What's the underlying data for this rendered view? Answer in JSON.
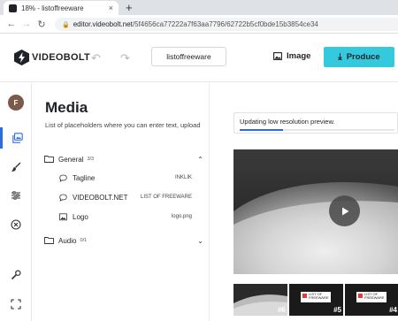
{
  "browser": {
    "tab_title": "18% - listoffreeware",
    "tab_close": "×",
    "new_tab": "+",
    "url_host": "editor.videobolt.net",
    "url_path": "/5f4656ca77222a7f63aa7796/62722b5cf0bde15b3854ce34"
  },
  "header": {
    "logo_text": "VIDEOBOLT",
    "project_name": "listoffreeware",
    "image_label": "Image",
    "produce_label": "Produce",
    "brand_color": "#35c9dd"
  },
  "rail": {
    "avatar_letter": "F",
    "icons": [
      "media-icon",
      "brush-icon",
      "sliders-icon",
      "music-icon",
      "wrench-icon",
      "fullscreen-icon"
    ],
    "active": "media-icon",
    "accent": "#2b6cde"
  },
  "media": {
    "title": "Media",
    "description": "List of placeholders where you can enter text, upload",
    "groups": [
      {
        "label": "General",
        "count": "3/3",
        "expanded": true,
        "items": [
          {
            "label": "Tagline",
            "value": "INKLIK",
            "icon": "text-bubble-icon"
          },
          {
            "label": "VIDEOBOLT.NET",
            "value": "LIST OF FREEWARE",
            "icon": "text-bubble-icon"
          },
          {
            "label": "Logo",
            "value": "logo.png",
            "icon": "image-icon"
          }
        ]
      },
      {
        "label": "Audio",
        "count": "0/1",
        "expanded": false,
        "items": []
      }
    ]
  },
  "preview": {
    "status_text": "Updating low resolution preview.",
    "progress": 0.28,
    "thumbnails": [
      {
        "number": "#6"
      },
      {
        "number": "#5",
        "card_text": "LIST OF FREEWARE"
      },
      {
        "number": "#4",
        "card_text": "LIST OF FREEWARE"
      }
    ]
  }
}
